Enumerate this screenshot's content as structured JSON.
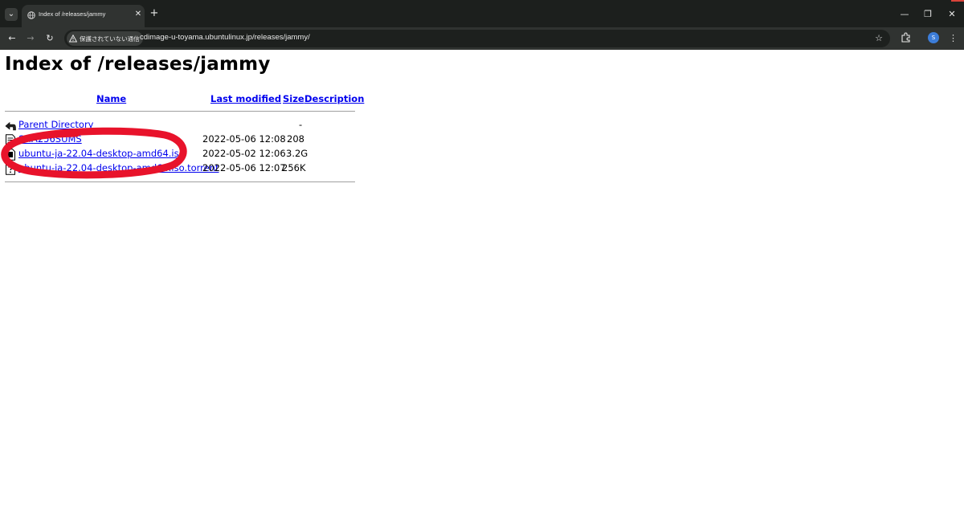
{
  "browser": {
    "tab_search_glyph": "⌄",
    "tab": {
      "title": "Index of /releases/jammy",
      "close": "✕"
    },
    "new_tab": "+",
    "window_controls": {
      "minimize": "—",
      "restore": "❐",
      "close": "✕"
    },
    "nav": {
      "back": "←",
      "forward": "→",
      "reload": "↻"
    },
    "omnibox": {
      "security_label": "保護されていない通信",
      "url": "cdimage-u-toyama.ubuntulinux.jp/releases/jammy/"
    },
    "bookmark_star": "☆",
    "profile_initial": "S",
    "menu": "⋮"
  },
  "page": {
    "title": "Index of /releases/jammy",
    "headers": {
      "name": "Name",
      "last_modified": "Last modified",
      "size": "Size",
      "description": "Description"
    },
    "rows": [
      {
        "icon": "back-icon",
        "name": "Parent Directory",
        "modified": "",
        "size": "-"
      },
      {
        "icon": "text-file-icon",
        "name": "SHA256SUMS",
        "modified": "2022-05-06 12:08",
        "size": "208"
      },
      {
        "icon": "binary-file-icon",
        "name": "ubuntu-ja-22.04-desktop-amd64.iso",
        "modified": "2022-05-02 12:06",
        "size": "3.2G"
      },
      {
        "icon": "unknown-file-icon",
        "name": "ubuntu-ja-22.04-desktop-amd64.iso.torrent",
        "modified": "2022-05-06 12:07",
        "size": "256K"
      }
    ]
  },
  "colors": {
    "link": "#0000ee",
    "annotation": "#e8132b",
    "chrome_dark": "#1c1f1d",
    "chrome_toolbar": "#303331"
  }
}
